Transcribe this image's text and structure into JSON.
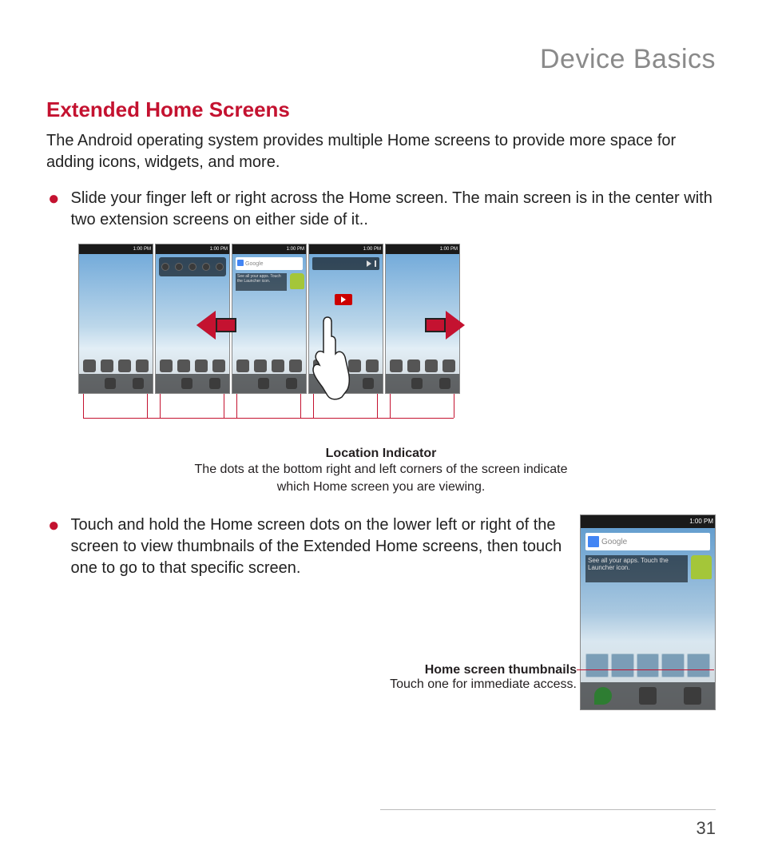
{
  "chapter_title": "Device Basics",
  "section_title": "Extended Home Screens",
  "intro": "The Android operating system provides multiple Home screens to provide more space for adding icons, widgets, and more.",
  "bullets": [
    "Slide your finger left or right across the Home screen. The main screen is in the center with two extension screens on either side of it..",
    "Touch and hold the Home screen dots on the lower left or right of the screen to view thumbnails of the Extended Home screens, then touch one to go to that specific screen."
  ],
  "status_time": "1:00 PM",
  "search_placeholder": "Google",
  "hint_text": "See all your apps. Touch the Launcher icon.",
  "location_caption": {
    "title": "Location Indicator",
    "body": "The dots at the bottom right and left corners of the screen indicate which Home screen you are viewing."
  },
  "thumb_caption": {
    "title": "Home screen thumbnails",
    "body": "Touch one for immediate access."
  },
  "page_number": "31"
}
